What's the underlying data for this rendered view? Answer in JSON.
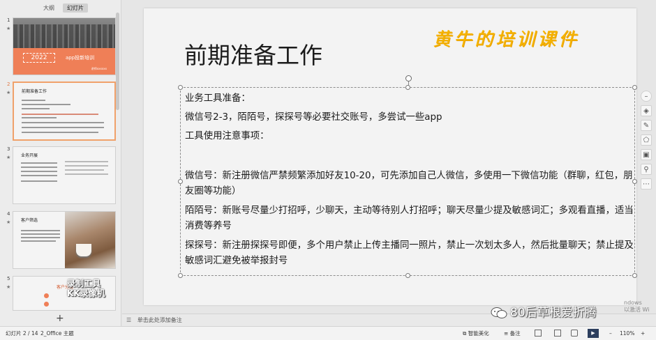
{
  "view_tabs": {
    "outline": "大纲",
    "slides": "幻灯片"
  },
  "thumbnails": [
    {
      "num": "1",
      "year": "2022",
      "title": "app投新培训",
      "sub": "讲师xxxxxx"
    },
    {
      "num": "2",
      "title": "前期准备工作"
    },
    {
      "num": "3",
      "title": "业务开展"
    },
    {
      "num": "4",
      "title": "客户筛选"
    },
    {
      "num": "5",
      "title": "客户分类"
    }
  ],
  "recorder_watermark": [
    "录制工具",
    "KK录像机"
  ],
  "add_slide_icon": "+",
  "slide": {
    "title": "前期准备工作",
    "brand": "黄牛的培训课件",
    "paragraphs": [
      "业务工具准备：",
      "微信号2-3，陌陌号，探探号等必要社交账号，多尝试一些app",
      "工具使用注意事项：",
      "",
      "微信号：新注册微信严禁频繁添加好友10-20，可先添加自己人微信，多使用一下微信功能（群聊，红包，朋友圈等功能）",
      "陌陌号：新账号尽量少打招呼，少聊天，主动等待别人打招呼；聊天尽量少提及敏感词汇；多观看直播，适当消费等养号",
      "探探号：新注册探探号即便，多个用户禁止上传主播同一照片，禁止一次划太多人，然后批量聊天；禁止提及敏感词汇避免被举报封号"
    ]
  },
  "notes_placeholder": "单击此处添加备注",
  "wechat_watermark": "80后草根爱折腾",
  "activate_text": [
    "ndows",
    "以激活 Wi"
  ],
  "status": {
    "slide_counter": "幻灯片 2 / 14",
    "theme": "2_Office 主题",
    "smart_beautify": "智能美化",
    "notes_btn": "备注",
    "zoom": "110%"
  },
  "tools": [
    "more-icon",
    "layers-icon",
    "pen-icon",
    "shape-icon",
    "frame-icon",
    "pin-icon",
    "ellipsis-icon"
  ],
  "colors": {
    "accent_orange": "#ef7f57",
    "brand_yellow": "#f6b400",
    "selection_border": "#f0a16a"
  }
}
